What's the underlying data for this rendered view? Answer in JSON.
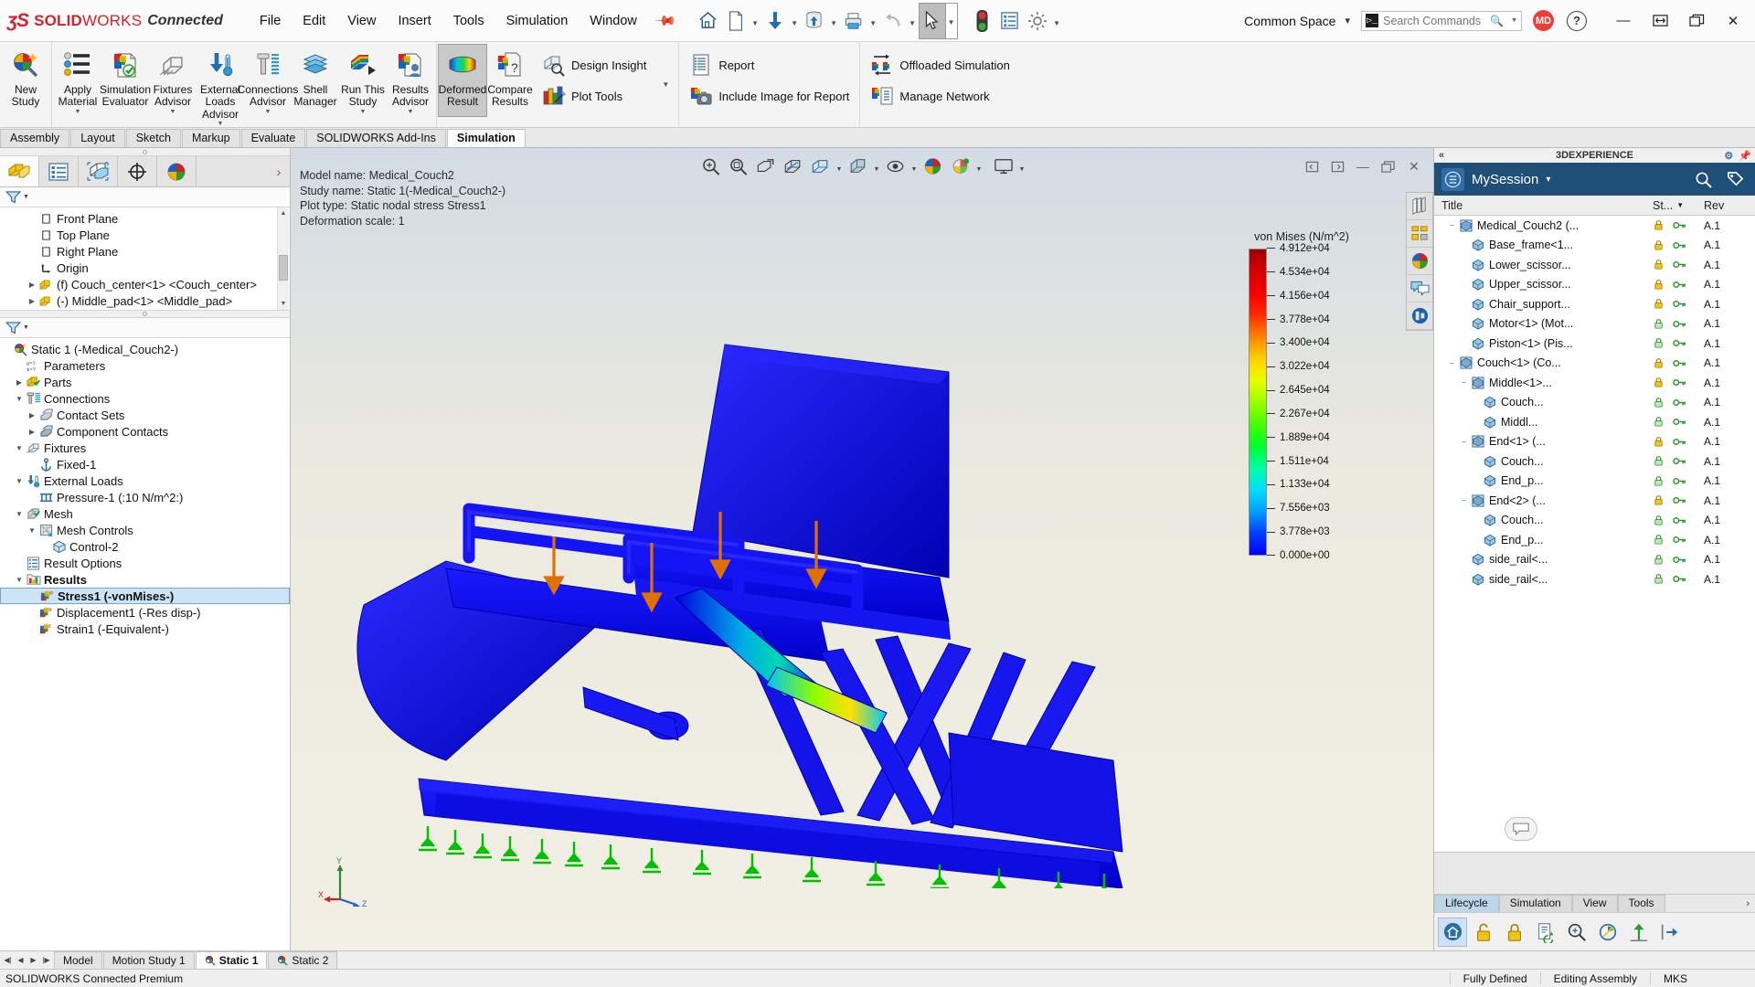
{
  "titlebar": {
    "brand_mark": "ʒS",
    "brand_solid": "SOLID",
    "brand_works": "WORKS",
    "brand_connected": "Connected",
    "menus": [
      "File",
      "Edit",
      "View",
      "Insert",
      "Tools",
      "Simulation",
      "Window"
    ],
    "pin_icon": "pin-icon",
    "quick_access": [
      {
        "name": "home-icon",
        "caret": false
      },
      {
        "name": "new-document-icon",
        "caret": true
      },
      {
        "name": "save-to-cloud-icon",
        "caret": true
      },
      {
        "name": "revision-icon",
        "caret": true
      },
      {
        "name": "print-icon",
        "caret": true
      },
      {
        "name": "undo-icon",
        "caret": true
      },
      {
        "name": "select-pointer-icon",
        "caret": true
      },
      {
        "name": "status-light-icon",
        "caret": false
      },
      {
        "name": "properties-icon",
        "caret": false
      },
      {
        "name": "options-gear-icon",
        "caret": true
      }
    ],
    "common_space": "Common Space",
    "search_placeholder": "Search Commands",
    "avatar_initials": "MD",
    "help_label": "?",
    "window_buttons": [
      "minimize",
      "restore-dual",
      "maximize-restore",
      "close"
    ]
  },
  "ribbon": {
    "buttons": [
      {
        "label": "New\nStudy",
        "name": "new-study",
        "icon": "new-study-icon"
      },
      {
        "label": "Apply\nMaterial",
        "name": "apply-material",
        "icon": "apply-material-icon",
        "caret": true
      },
      {
        "label": "Simulation\nEvaluator",
        "name": "simulation-evaluator",
        "icon": "simulation-evaluator-icon"
      },
      {
        "label": "Fixtures\nAdvisor",
        "name": "fixtures-advisor",
        "icon": "fixtures-advisor-icon",
        "caret": true
      },
      {
        "label": "External\nLoads\nAdvisor",
        "name": "external-loads-advisor",
        "icon": "external-loads-icon",
        "caret": true
      },
      {
        "label": "Connections\nAdvisor",
        "name": "connections-advisor",
        "icon": "connections-advisor-icon",
        "caret": true
      },
      {
        "label": "Shell\nManager",
        "name": "shell-manager",
        "icon": "shell-manager-icon"
      },
      {
        "label": "Run This\nStudy",
        "name": "run-this-study",
        "icon": "run-study-icon",
        "caret": true
      },
      {
        "label": "Results\nAdvisor",
        "name": "results-advisor",
        "icon": "results-advisor-icon",
        "caret": true
      },
      {
        "label": "Deformed\nResult",
        "name": "deformed-result",
        "icon": "deformed-result-icon",
        "active": true
      },
      {
        "label": "Compare\nResults",
        "name": "compare-results",
        "icon": "compare-results-icon"
      }
    ],
    "group_plot": [
      {
        "label": "Design Insight",
        "name": "design-insight",
        "icon": "design-insight-icon"
      },
      {
        "label": "Plot Tools",
        "name": "plot-tools",
        "icon": "plot-tools-icon",
        "caret": true
      }
    ],
    "group_report": [
      {
        "label": "Report",
        "name": "report",
        "icon": "report-icon"
      },
      {
        "label": "Include Image for Report",
        "name": "include-image-for-report",
        "icon": "camera-icon"
      }
    ],
    "group_network": [
      {
        "label": "Offloaded Simulation",
        "name": "offloaded-simulation",
        "icon": "offloaded-simulation-icon"
      },
      {
        "label": "Manage Network",
        "name": "manage-network",
        "icon": "manage-network-icon"
      }
    ]
  },
  "tabs": {
    "items": [
      "Assembly",
      "Layout",
      "Sketch",
      "Markup",
      "Evaluate",
      "SOLIDWORKS Add-Ins",
      "Simulation"
    ],
    "selected": "Simulation"
  },
  "left_panel": {
    "tabs": [
      {
        "name": "feature-manager-tab",
        "icon": "yellow-block-icon",
        "selected": true
      },
      {
        "name": "property-manager-tab",
        "icon": "property-list-icon"
      },
      {
        "name": "configuration-manager-tab",
        "icon": "configuration-icon"
      },
      {
        "name": "dimxpert-manager-tab",
        "icon": "crosshair-icon"
      },
      {
        "name": "display-manager-tab",
        "icon": "appearance-sphere-icon"
      }
    ],
    "filter_icon": "filter-funnel-icon",
    "feature_tree": [
      {
        "label": "Front Plane",
        "icon": "plane-icon",
        "indent": 2,
        "twisty": ""
      },
      {
        "label": "Top Plane",
        "icon": "plane-icon",
        "indent": 2,
        "twisty": ""
      },
      {
        "label": "Right Plane",
        "icon": "plane-icon",
        "indent": 2,
        "twisty": ""
      },
      {
        "label": "Origin",
        "icon": "origin-icon",
        "indent": 2,
        "twisty": ""
      },
      {
        "label": "(f) Couch_center<1>  <Couch_center>",
        "icon": "part-icon",
        "indent": 1,
        "twisty": "▶"
      },
      {
        "label": "(-) Middle_pad<1>  <Middle_pad>",
        "icon": "part-icon",
        "indent": 1,
        "twisty": "▶"
      }
    ],
    "sim_tree": [
      {
        "label": "Static 1 (-Medical_Couch2-)",
        "icon": "study-icon",
        "indent": 0,
        "twisty": ""
      },
      {
        "label": "Parameters",
        "icon": "parameters-icon",
        "indent": 1,
        "twisty": ""
      },
      {
        "label": "Parts",
        "icon": "parts-icon",
        "indent": 1,
        "twisty": "▶"
      },
      {
        "label": "Connections",
        "icon": "connections-icon",
        "indent": 1,
        "twisty": "▼"
      },
      {
        "label": "Contact Sets",
        "icon": "contact-sets-icon",
        "indent": 2,
        "twisty": "▶"
      },
      {
        "label": "Component Contacts",
        "icon": "component-contacts-icon",
        "indent": 2,
        "twisty": "▶"
      },
      {
        "label": "Fixtures",
        "icon": "fixtures-icon",
        "indent": 1,
        "twisty": "▼"
      },
      {
        "label": "Fixed-1",
        "icon": "fixed-anchor-icon",
        "indent": 2,
        "twisty": ""
      },
      {
        "label": "External Loads",
        "icon": "external-loads-icon",
        "indent": 1,
        "twisty": "▼"
      },
      {
        "label": "Pressure-1 (:10 N/m^2:)",
        "icon": "pressure-icon",
        "indent": 2,
        "twisty": ""
      },
      {
        "label": "Mesh",
        "icon": "mesh-icon",
        "indent": 1,
        "twisty": "▼"
      },
      {
        "label": "Mesh Controls",
        "icon": "mesh-controls-icon",
        "indent": 2,
        "twisty": "▼"
      },
      {
        "label": "Control-2",
        "icon": "control-cube-icon",
        "indent": 3,
        "twisty": ""
      },
      {
        "label": "Result Options",
        "icon": "result-options-icon",
        "indent": 1,
        "twisty": ""
      },
      {
        "label": "Results",
        "icon": "results-folder-icon",
        "indent": 1,
        "twisty": "▼",
        "bold": true
      },
      {
        "label": "Stress1 (-vonMises-)",
        "icon": "stress-plot-icon",
        "indent": 2,
        "twisty": "",
        "selected": true
      },
      {
        "label": "Displacement1 (-Res disp-)",
        "icon": "displacement-plot-icon",
        "indent": 2,
        "twisty": ""
      },
      {
        "label": "Strain1 (-Equivalent-)",
        "icon": "strain-plot-icon",
        "indent": 2,
        "twisty": ""
      }
    ]
  },
  "graphics": {
    "view_toolbar": [
      {
        "name": "zoom-to-fit-icon",
        "caret": false
      },
      {
        "name": "zoom-to-area-icon",
        "caret": false
      },
      {
        "name": "previous-view-icon",
        "caret": false
      },
      {
        "name": "section-view-icon",
        "caret": false
      },
      {
        "name": "view-orientation-icon",
        "caret": true
      },
      {
        "name": "display-style-icon",
        "caret": true
      },
      {
        "name": "hide-show-items-icon",
        "caret": true
      },
      {
        "name": "appearances-icon",
        "caret": false
      },
      {
        "name": "scene-icon",
        "caret": true
      },
      {
        "name": "view-settings-icon",
        "caret": true
      }
    ],
    "window_controls": [
      "restore-left",
      "restore-right",
      "minimize",
      "restore",
      "close"
    ],
    "plot_info": [
      "Model name: Medical_Couch2",
      "Study name: Static 1(-Medical_Couch2-)",
      "Plot type: Static nodal stress Stress1",
      "Deformation scale: 1"
    ],
    "right_dock": [
      {
        "name": "display-pane-icon"
      },
      {
        "name": "assembly-visualization-icon"
      },
      {
        "name": "appearances-sphere-icon"
      },
      {
        "name": "comments-icon"
      },
      {
        "name": "simulation-display-icon"
      }
    ],
    "triad": {
      "x": "X",
      "y": "Y",
      "z": "Z"
    }
  },
  "chart_data": {
    "type": "heatmap",
    "title": "von Mises (N/m^2)",
    "unit": "N/m^2",
    "quantity": "von Mises",
    "ylim": [
      0,
      49120
    ],
    "tick_labels": [
      "4.912e+04",
      "4.534e+04",
      "4.156e+04",
      "3.778e+04",
      "3.400e+04",
      "3.022e+04",
      "2.645e+04",
      "2.267e+04",
      "1.889e+04",
      "1.511e+04",
      "1.133e+04",
      "7.556e+03",
      "3.778e+03",
      "0.000e+00"
    ],
    "tick_values": [
      49120,
      45340,
      41560,
      37780,
      34000,
      30220,
      26450,
      22670,
      18890,
      15110,
      11330,
      7556,
      3778,
      0
    ],
    "colormap": [
      "#0000ff",
      "#00a0ff",
      "#00ffd0",
      "#00ff2a",
      "#9dff00",
      "#ffe000",
      "#ff8400",
      "#ff0000",
      "#9e0000"
    ],
    "legend_position": "right"
  },
  "right_panel": {
    "header_title": "3DEXPERIENCE",
    "collapse_icon": "chevron-double-left-icon",
    "header_icons": [
      "gear-icon",
      "pin-icon"
    ],
    "session_title": "MySession",
    "session_icons": [
      "search-icon",
      "tag-icon"
    ],
    "columns": [
      "Title",
      "St...",
      "Rev"
    ],
    "rows": [
      {
        "label": "Medical_Couch2 (...",
        "indent": 1,
        "twisty": "−",
        "icon": "assembly-icon",
        "lock": "lock-icon",
        "status": "key-icon",
        "rev": "A.1"
      },
      {
        "label": "Base_frame<1...",
        "indent": 2,
        "twisty": "",
        "icon": "part-blue-icon",
        "lock": "lock-icon",
        "status": "key-icon",
        "rev": "A.1"
      },
      {
        "label": "Lower_scissor...",
        "indent": 2,
        "twisty": "",
        "icon": "part-blue-icon",
        "lock": "lock-icon",
        "status": "key-icon",
        "rev": "A.1"
      },
      {
        "label": "Upper_scissor...",
        "indent": 2,
        "twisty": "",
        "icon": "part-blue-icon",
        "lock": "lock-icon",
        "status": "key-icon",
        "rev": "A.1"
      },
      {
        "label": "Chair_support...",
        "indent": 2,
        "twisty": "",
        "icon": "part-blue-icon",
        "lock": "lock-icon",
        "status": "key-icon",
        "rev": "A.1"
      },
      {
        "label": "Motor<1> (Mot...",
        "indent": 2,
        "twisty": "",
        "icon": "part-blue-icon",
        "lock": "lock-green-icon",
        "status": "key-icon",
        "rev": "A.1"
      },
      {
        "label": "Piston<1> (Pis...",
        "indent": 2,
        "twisty": "",
        "icon": "part-blue-icon",
        "lock": "lock-green-icon",
        "status": "key-icon",
        "rev": "A.1"
      },
      {
        "label": "Couch<1> (Co...",
        "indent": 1,
        "twisty": "−",
        "icon": "assembly-icon",
        "lock": "lock-icon",
        "status": "key-icon",
        "rev": "A.1"
      },
      {
        "label": "Middle<1>...",
        "indent": 2,
        "twisty": "−",
        "icon": "assembly-icon",
        "lock": "lock-icon",
        "status": "key-icon",
        "rev": "A.1"
      },
      {
        "label": "Couch...",
        "indent": 3,
        "twisty": "",
        "icon": "part-blue-icon",
        "lock": "lock-green-icon",
        "status": "key-icon",
        "rev": "A.1"
      },
      {
        "label": "Middl...",
        "indent": 3,
        "twisty": "",
        "icon": "part-blue-icon",
        "lock": "lock-green-icon",
        "status": "key-icon",
        "rev": "A.1"
      },
      {
        "label": "End<1> (...",
        "indent": 2,
        "twisty": "−",
        "icon": "assembly-icon",
        "lock": "lock-icon",
        "status": "key-icon",
        "rev": "A.1"
      },
      {
        "label": "Couch...",
        "indent": 3,
        "twisty": "",
        "icon": "part-blue-icon",
        "lock": "lock-green-icon",
        "status": "key-icon",
        "rev": "A.1"
      },
      {
        "label": "End_p...",
        "indent": 3,
        "twisty": "",
        "icon": "part-blue-icon",
        "lock": "lock-green-icon",
        "status": "key-icon",
        "rev": "A.1"
      },
      {
        "label": "End<2> (...",
        "indent": 2,
        "twisty": "−",
        "icon": "assembly-icon",
        "lock": "lock-icon",
        "status": "key-icon",
        "rev": "A.1"
      },
      {
        "label": "Couch...",
        "indent": 3,
        "twisty": "",
        "icon": "part-blue-icon",
        "lock": "lock-green-icon",
        "status": "key-icon",
        "rev": "A.1"
      },
      {
        "label": "End_p...",
        "indent": 3,
        "twisty": "",
        "icon": "part-blue-icon",
        "lock": "lock-green-icon",
        "status": "key-icon",
        "rev": "A.1"
      },
      {
        "label": "side_rail<...",
        "indent": 2,
        "twisty": "",
        "icon": "part-blue-icon",
        "lock": "lock-green-icon",
        "status": "key-icon",
        "rev": "A.1"
      },
      {
        "label": "side_rail<...",
        "indent": 2,
        "twisty": "",
        "icon": "part-blue-icon",
        "lock": "lock-green-icon",
        "status": "key-icon",
        "rev": "A.1"
      }
    ],
    "bottom_tabs": [
      {
        "label": "Lifecycle",
        "selected": true
      },
      {
        "label": "Simulation",
        "selected": false
      },
      {
        "label": "View",
        "selected": false
      },
      {
        "label": "Tools",
        "selected": false
      }
    ],
    "tools": [
      {
        "name": "lifecycle-home-icon",
        "selected": true
      },
      {
        "name": "unlock-icon"
      },
      {
        "name": "lock-icon"
      },
      {
        "name": "revise-icon"
      },
      {
        "name": "compare-icon"
      },
      {
        "name": "maturity-icon"
      },
      {
        "name": "promote-icon"
      },
      {
        "name": "demote-icon"
      }
    ],
    "scroll_arrow": "chevron-right-icon"
  },
  "bottom": {
    "nav_icons": [
      "first",
      "prev",
      "next",
      "last"
    ],
    "tabs": [
      {
        "label": "Model",
        "icon": "",
        "selected": false
      },
      {
        "label": "Motion Study 1",
        "icon": "",
        "selected": false
      },
      {
        "label": "Static 1",
        "icon": "study-icon",
        "selected": true
      },
      {
        "label": "Static 2",
        "icon": "study-icon",
        "selected": false
      }
    ]
  },
  "status": {
    "left": "SOLIDWORKS Connected Premium",
    "right": [
      "Fully Defined",
      "Editing Assembly",
      "MKS",
      ""
    ]
  }
}
